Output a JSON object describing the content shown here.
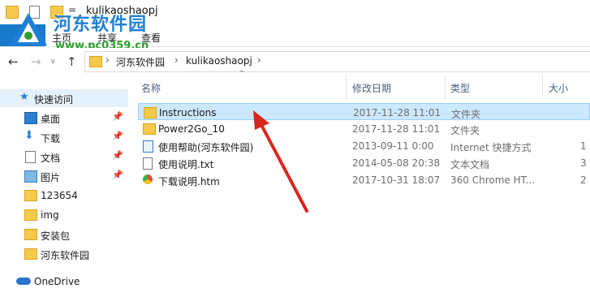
{
  "window": {
    "title": "kulikaoshaopj",
    "title_caret": "="
  },
  "watermark": {
    "name": "河东软件园",
    "url": "www.pc0359.cn"
  },
  "ribbon": {
    "tabs": [
      {
        "label": "主页"
      },
      {
        "label": "共享"
      },
      {
        "label": "查看"
      }
    ]
  },
  "nav": {
    "back": "←",
    "forward": "→",
    "recent": "∨",
    "up": "↑",
    "breadcrumb": [
      "河东软件园",
      "kulikaoshaopj"
    ],
    "sep": "›"
  },
  "sidebar": {
    "items": [
      {
        "label": "快速访问",
        "icon": "star-icon"
      },
      {
        "label": "桌面",
        "icon": "desktop-icon",
        "pinned": true
      },
      {
        "label": "下载",
        "icon": "download-icon",
        "pinned": true
      },
      {
        "label": "文档",
        "icon": "document-icon",
        "pinned": true
      },
      {
        "label": "图片",
        "icon": "pictures-icon",
        "pinned": true
      },
      {
        "label": "123654",
        "icon": "folder-icon"
      },
      {
        "label": "img",
        "icon": "folder-icon"
      },
      {
        "label": "安装包",
        "icon": "folder-icon"
      },
      {
        "label": "河东软件园",
        "icon": "folder-icon"
      },
      {
        "label": "OneDrive",
        "icon": "onedrive-icon"
      }
    ],
    "pin_glyph": "📌"
  },
  "columns": {
    "name": "名称",
    "modified": "修改日期",
    "type": "类型",
    "size": "大小",
    "sort_glyph": "^"
  },
  "files": [
    {
      "name": "Instructions",
      "modified": "2017-11-28 11:01",
      "type": "文件夹",
      "size": "",
      "icon": "folder-icon",
      "selected": true
    },
    {
      "name": "Power2Go_10",
      "modified": "2017-11-28 11:01",
      "type": "文件夹",
      "size": "",
      "icon": "folder-icon"
    },
    {
      "name": "使用帮助(河东软件园)",
      "modified": "2013-09-11 0:00",
      "type": "Internet 快捷方式",
      "size": "1",
      "icon": "internet-shortcut-icon"
    },
    {
      "name": "使用说明.txt",
      "modified": "2014-05-08 20:38",
      "type": "文本文档",
      "size": "3",
      "icon": "text-file-icon"
    },
    {
      "name": "下载说明.htm",
      "modified": "2017-10-31 18:07",
      "type": "360 Chrome HT...",
      "size": "2",
      "icon": "html-file-icon"
    }
  ],
  "colors": {
    "accent": "#1979ca",
    "selection": "#cce8ff",
    "arrow": "#d9261c"
  }
}
